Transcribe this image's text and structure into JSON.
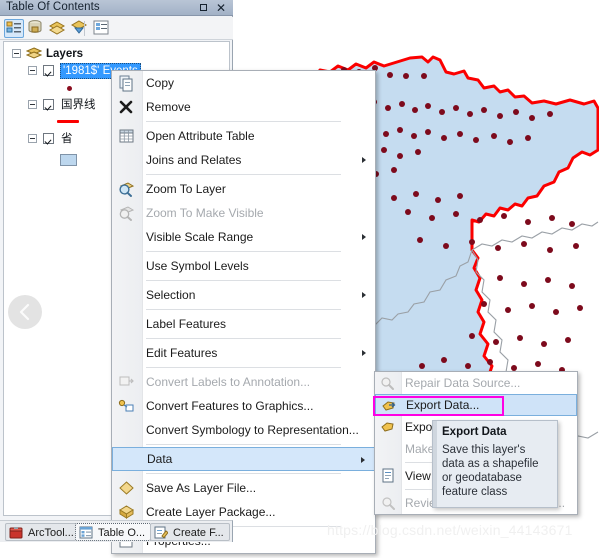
{
  "panel": {
    "title": "Table Of Contents",
    "maximize_label": "Maximize",
    "close_label": "✕",
    "toolbar_icons": [
      {
        "name": "list-by-drawing-order-icon",
        "label": "List By Drawing Order"
      },
      {
        "name": "list-by-source-icon",
        "label": "List By Source"
      },
      {
        "name": "list-by-visibility-icon",
        "label": "List By Visibility"
      },
      {
        "name": "list-by-selection-icon",
        "label": "List By Selection"
      },
      {
        "name": "options-icon",
        "label": "Options"
      }
    ]
  },
  "toc": {
    "root": "Layers",
    "layers": [
      {
        "label": "'1981$' Events",
        "selected": true,
        "symbol": "point"
      },
      {
        "label": "国界线",
        "selected": false,
        "symbol": "line"
      },
      {
        "label": "省",
        "selected": false,
        "symbol": "polygon"
      }
    ]
  },
  "collapse_button": {
    "name": "collapse-panel-button",
    "glyph": "‹"
  },
  "context_menu": {
    "items": [
      {
        "label": "Copy",
        "icon": "copy-icon",
        "disabled": false,
        "submenu": false,
        "sep_after": false
      },
      {
        "label": "Remove",
        "icon": "remove-icon",
        "disabled": false,
        "submenu": false,
        "sep_after": true
      },
      {
        "label": "Open Attribute Table",
        "icon": "attribute-table-icon",
        "disabled": false,
        "submenu": false,
        "sep_after": false
      },
      {
        "label": "Joins and Relates",
        "icon": "",
        "disabled": false,
        "submenu": true,
        "sep_after": true
      },
      {
        "label": "Zoom To Layer",
        "icon": "zoom-to-layer-icon",
        "disabled": false,
        "submenu": false,
        "sep_after": false
      },
      {
        "label": "Zoom To Make Visible",
        "icon": "zoom-make-visible-icon",
        "disabled": true,
        "submenu": false,
        "sep_after": false
      },
      {
        "label": "Visible Scale Range",
        "icon": "",
        "disabled": false,
        "submenu": true,
        "sep_after": true
      },
      {
        "label": "Use Symbol Levels",
        "icon": "",
        "disabled": false,
        "submenu": false,
        "sep_after": true
      },
      {
        "label": "Selection",
        "icon": "",
        "disabled": false,
        "submenu": true,
        "sep_after": true
      },
      {
        "label": "Label Features",
        "icon": "",
        "disabled": false,
        "submenu": false,
        "sep_after": true
      },
      {
        "label": "Edit Features",
        "icon": "",
        "disabled": false,
        "submenu": true,
        "sep_after": true
      },
      {
        "label": "Convert Labels to Annotation...",
        "icon": "convert-labels-icon",
        "disabled": true,
        "submenu": false,
        "sep_after": false
      },
      {
        "label": "Convert Features to Graphics...",
        "icon": "convert-features-icon",
        "disabled": false,
        "submenu": false,
        "sep_after": false
      },
      {
        "label": "Convert Symbology to Representation...",
        "icon": "",
        "disabled": false,
        "submenu": false,
        "sep_after": true
      },
      {
        "label": "Data",
        "icon": "",
        "disabled": false,
        "submenu": true,
        "highlighted": true,
        "sep_after": true
      },
      {
        "label": "Save As Layer File...",
        "icon": "save-layer-file-icon",
        "disabled": false,
        "submenu": false,
        "sep_after": false
      },
      {
        "label": "Create Layer Package...",
        "icon": "layer-package-icon",
        "disabled": false,
        "submenu": false,
        "sep_after": true
      },
      {
        "label": "Properties...",
        "icon": "properties-icon",
        "disabled": false,
        "submenu": false,
        "sep_after": false
      }
    ]
  },
  "data_submenu": {
    "items": [
      {
        "label": "Repair Data Source...",
        "icon": "repair-data-source-icon",
        "disabled": true,
        "highlighted": false
      },
      {
        "label": "Export Data...",
        "icon": "export-data-icon",
        "disabled": false,
        "highlighted": true
      },
      {
        "label": "Export To CAD...",
        "icon": "export-cad-icon",
        "disabled": false,
        "highlighted": false
      },
      {
        "label": "Make Permanent...",
        "icon": "make-permanent-icon",
        "disabled": true,
        "highlighted": false
      },
      {
        "label": "View Item Description...",
        "icon": "view-description-icon",
        "disabled": false,
        "highlighted": false
      },
      {
        "label": "Review/Rematch Addresses...",
        "icon": "review-addresses-icon",
        "disabled": true,
        "highlighted": false
      }
    ]
  },
  "tooltip": {
    "title": "Export Data",
    "body": "Save this layer's data as a shapefile or geodatabase feature class"
  },
  "tabs": [
    {
      "label": "ArcTool...",
      "icon": "arctoolbox-icon",
      "active": false
    },
    {
      "label": "Table O...",
      "icon": "table-of-contents-icon",
      "active": true
    },
    {
      "label": "Create F...",
      "icon": "create-features-icon",
      "active": false
    }
  ],
  "watermark": "https://blog.csdn.net/weixin_44143671",
  "map": {
    "border_color": "#fb0000",
    "fill_color": "#c5dcf0",
    "interior_line_color": "#9aa0a6",
    "point_color": "#7d0a1c"
  }
}
